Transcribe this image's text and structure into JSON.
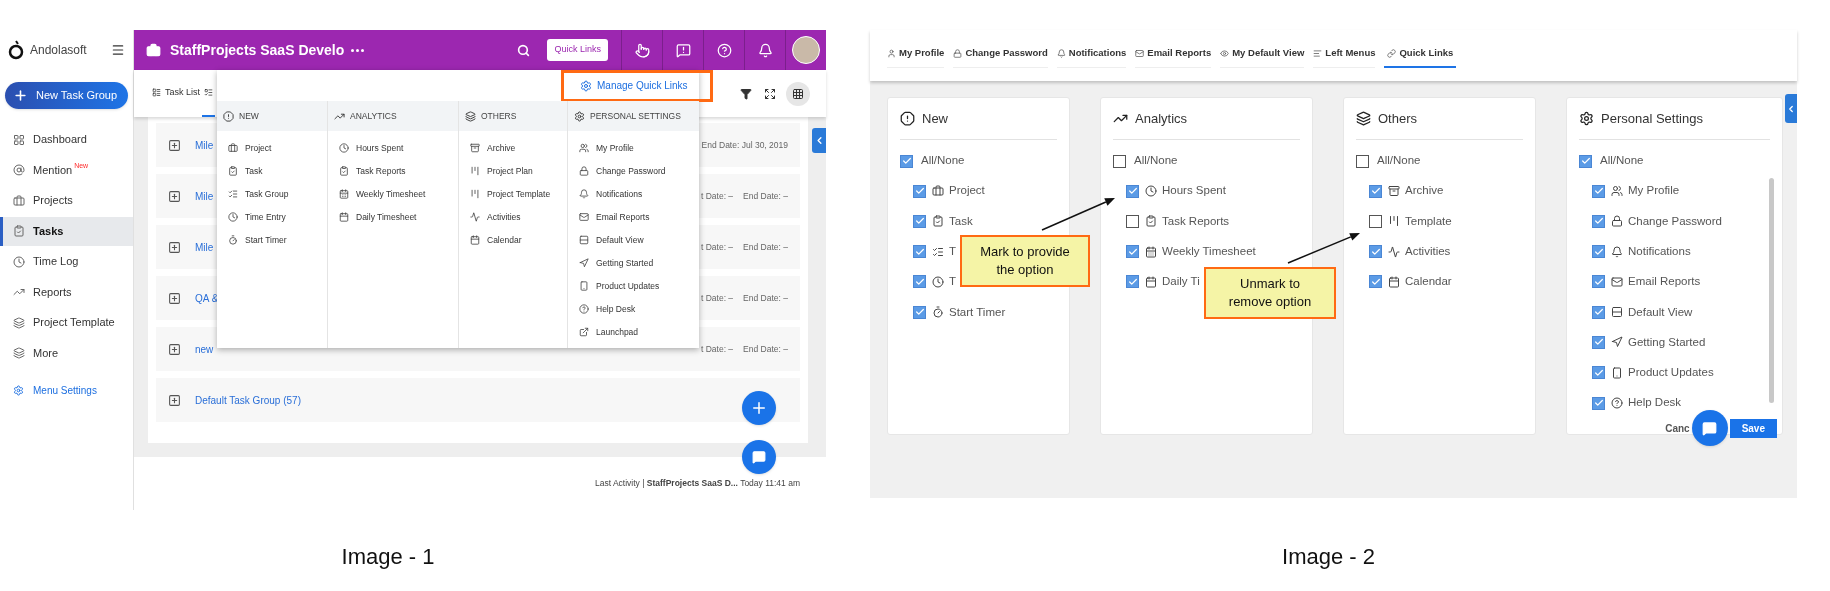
{
  "image_1": {
    "sidebar": {
      "logo_text": "Andolasoft",
      "new_button": "New Task Group",
      "items": [
        {
          "label": "Dashboard",
          "selected": false
        },
        {
          "label": "Mention",
          "badge": "New",
          "selected": false
        },
        {
          "label": "Projects",
          "selected": false
        },
        {
          "label": "Tasks",
          "selected": true
        },
        {
          "label": "Time Log",
          "selected": false
        },
        {
          "label": "Reports",
          "selected": false
        },
        {
          "label": "Project Template",
          "selected": false
        },
        {
          "label": "More",
          "selected": false
        }
      ],
      "settings_link": "Menu Settings"
    },
    "header": {
      "title": "StaffProjects SaaS Develo",
      "quick_links_button": "Quick Links"
    },
    "toolbar": {
      "tabs": [
        {
          "label": "Task List",
          "selected": false
        },
        {
          "selected": true
        }
      ]
    },
    "task_groups": [
      {
        "name": "Mile",
        "dates": [
          "End Date: Jul 30, 2019"
        ]
      },
      {
        "name": "Mile",
        "dates": [
          "t Date: –",
          "End Date: –"
        ]
      },
      {
        "name": "Mile",
        "dates": [
          "t Date: –",
          "End Date: –"
        ]
      },
      {
        "name": "QA &",
        "dates": [
          "t Date: –",
          "End Date: –"
        ]
      },
      {
        "name": "new",
        "dates": [
          "t Date: –",
          "End Date: –"
        ]
      },
      {
        "name": "Default Task Group (57)"
      }
    ],
    "quick_links_menu": {
      "manage_link": "Manage Quick Links",
      "columns": [
        {
          "title": "NEW",
          "items": [
            "Project",
            "Task",
            "Task Group",
            "Time Entry",
            "Start Timer"
          ]
        },
        {
          "title": "ANALYTICS",
          "items": [
            "Hours Spent",
            "Task Reports",
            "Weekly Timesheet",
            "Daily Timesheet"
          ]
        },
        {
          "title": "OTHERS",
          "items": [
            "Archive",
            "Project Plan",
            "Project Template",
            "Activities",
            "Calendar"
          ]
        },
        {
          "title": "PERSONAL SETTINGS",
          "items": [
            "My Profile",
            "Change Password",
            "Notifications",
            "Email Reports",
            "Default View",
            "Getting Started",
            "Product Updates",
            "Help Desk",
            "Launchpad"
          ]
        }
      ]
    },
    "footer": {
      "text": "Last Activity | **StaffProjects SaaS D...** Today 11:41 am"
    },
    "caption": "Image - 1"
  },
  "image_2": {
    "tabs": [
      {
        "label": "My Profile",
        "selected": false
      },
      {
        "label": "Change Password",
        "selected": false
      },
      {
        "label": "Notifications",
        "selected": false
      },
      {
        "label": "Email Reports",
        "selected": false
      },
      {
        "label": "My Default View",
        "selected": false
      },
      {
        "label": "Left Menus",
        "selected": false
      },
      {
        "label": "Quick Links",
        "selected": true
      }
    ],
    "cards": [
      {
        "title": "New",
        "all_label": "All/None",
        "all_checked": true,
        "items": [
          {
            "label": "Project",
            "checked": true
          },
          {
            "label": "Task",
            "checked": true
          },
          {
            "label": "T",
            "checked": true
          },
          {
            "label": "T",
            "checked": true
          },
          {
            "label": "Start Timer",
            "checked": true
          }
        ]
      },
      {
        "title": "Analytics",
        "all_label": "All/None",
        "all_checked": false,
        "items": [
          {
            "label": "Hours Spent",
            "checked": true
          },
          {
            "label": "Task Reports",
            "checked": false
          },
          {
            "label": "Weekly Timesheet",
            "checked": true
          },
          {
            "label": "Daily Ti",
            "checked": true
          }
        ]
      },
      {
        "title": "Others",
        "all_label": "All/None",
        "all_checked": false,
        "items": [
          {
            "label": "Archive",
            "checked": true
          },
          {
            "label": "Template",
            "checked": false
          },
          {
            "label": "Activities",
            "checked": true
          },
          {
            "label": "Calendar",
            "checked": true
          }
        ]
      },
      {
        "title": "Personal Settings",
        "all_label": "All/None",
        "all_checked": true,
        "items": [
          {
            "label": "My Profile",
            "checked": true
          },
          {
            "label": "Change Password",
            "checked": true
          },
          {
            "label": "Notifications",
            "checked": true
          },
          {
            "label": "Email Reports",
            "checked": true
          },
          {
            "label": "Default View",
            "checked": true
          },
          {
            "label": "Getting Started",
            "checked": true
          },
          {
            "label": "Product Updates",
            "checked": true
          },
          {
            "label": "Help Desk",
            "checked": true
          }
        ]
      }
    ],
    "callouts": [
      {
        "text": "Mark to provide the option"
      },
      {
        "text": "Unmark to remove option"
      }
    ],
    "buttons": {
      "cancel": "Canc",
      "save": "Save"
    },
    "caption": "Image - 2"
  }
}
